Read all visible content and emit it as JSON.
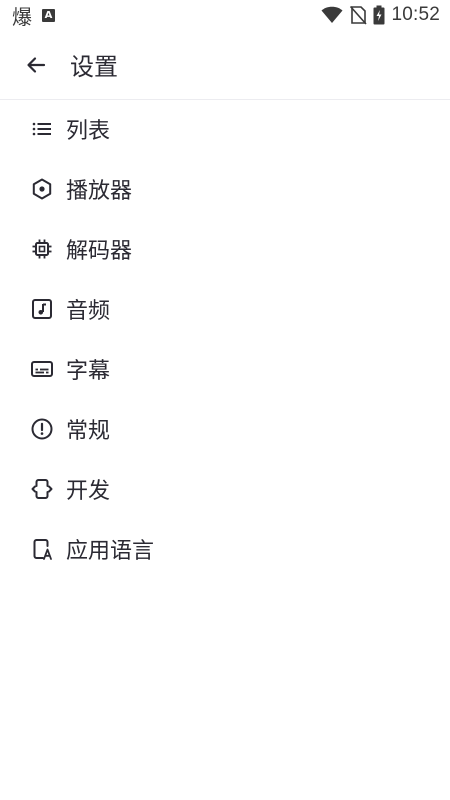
{
  "status_bar": {
    "left_glyph": "爆",
    "left_badge": "A",
    "time": "10:52",
    "icons": [
      "wifi-icon",
      "no-sim-icon",
      "battery-charging-icon"
    ]
  },
  "app_bar": {
    "back_icon": "arrow-back-icon",
    "title": "设置"
  },
  "settings": {
    "items": [
      {
        "label": "列表",
        "icon": "list-icon"
      },
      {
        "label": "播放器",
        "icon": "hexagon-dot-icon"
      },
      {
        "label": "解码器",
        "icon": "chip-icon"
      },
      {
        "label": "音频",
        "icon": "music-note-icon"
      },
      {
        "label": "字幕",
        "icon": "subtitles-icon"
      },
      {
        "label": "常规",
        "icon": "info-circle-icon"
      },
      {
        "label": "开发",
        "icon": "developer-mode-icon"
      },
      {
        "label": "应用语言",
        "icon": "app-language-icon"
      }
    ]
  },
  "colors": {
    "text": "#2b2a33",
    "icon": "#2b2a33",
    "divider": "#ececf0",
    "background": "#ffffff"
  }
}
